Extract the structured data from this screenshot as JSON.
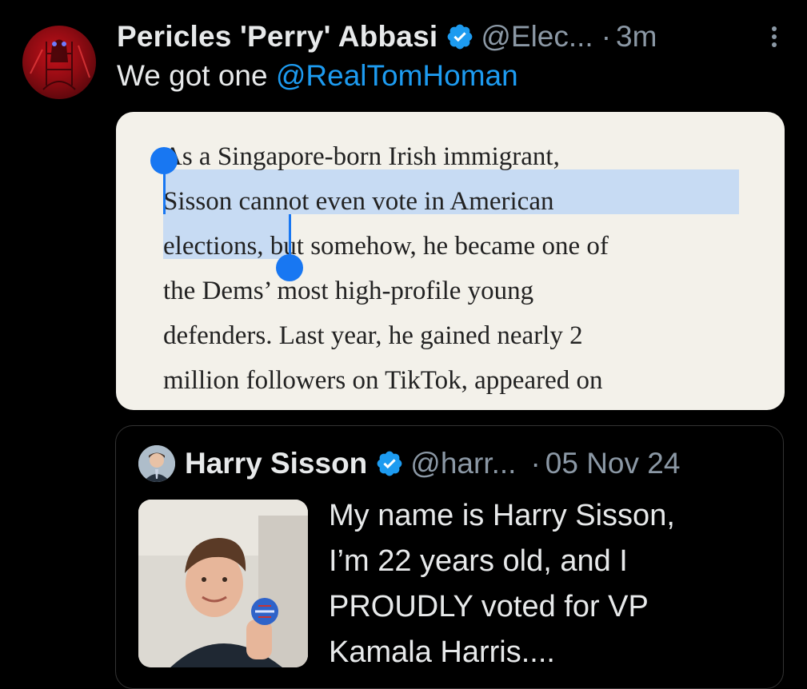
{
  "tweet": {
    "display_name": "Pericles 'Perry' Abbasi",
    "handle": "@Elec...",
    "separator": "·",
    "time": "3m",
    "text_prefix": "We got one ",
    "mention": "@RealTomHoman"
  },
  "article": {
    "lines": [
      "As a Singapore-born Irish immigrant,",
      "Sisson cannot even vote in American",
      "elections, but somehow, he became one of",
      "the Dems’ most high-profile young",
      "defenders. Last year, he gained nearly 2",
      "million followers on TikTok, appeared on"
    ]
  },
  "quote": {
    "display_name": "Harry Sisson",
    "handle": "@harr...",
    "separator": "·",
    "time": "05 Nov 24",
    "text_lines": [
      "My name is Harry Sisson,",
      "I’m 22 years old, and I",
      "PROUDLY voted for VP",
      "Kamala Harris...."
    ]
  },
  "colors": {
    "background": "#000000",
    "text": "#e7e9ea",
    "muted": "#8b98a5",
    "link": "#1d9bf0",
    "verified": "#1d9bf0",
    "selection": "#c7dbf3",
    "selection_handle": "#1877f2",
    "card_bg": "#f3f1ea"
  },
  "icons": [
    "verified-badge-icon",
    "more-options-icon",
    "selection-start-handle",
    "selection-end-handle"
  ]
}
